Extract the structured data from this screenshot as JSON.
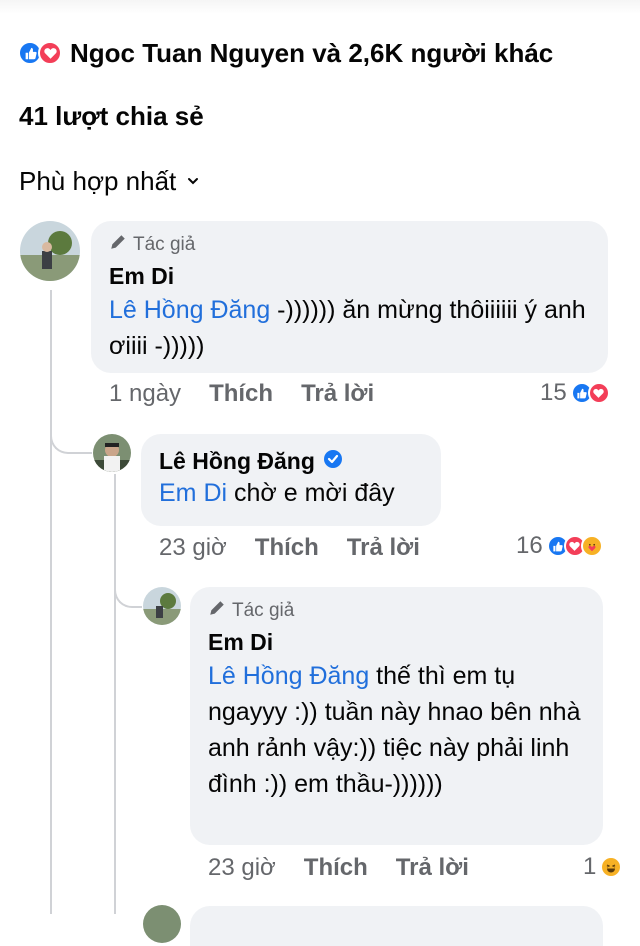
{
  "reactions_summary": {
    "icons": [
      "like-icon",
      "love-icon"
    ],
    "text": "Ngoc Tuan Nguyen và 2,6K người khác"
  },
  "shares": "41 lượt chia sẻ",
  "sort": {
    "label": "Phù hợp nhất",
    "chevron": "⌄"
  },
  "comments": [
    {
      "author_tag": "Tác giả",
      "name": "Em Di",
      "mention": "Lê Hồng Đăng",
      "text": " -)))))) ăn mừng thôiiiiii ý anh ơiiii -)))))",
      "time": "1 ngày",
      "like": "Thích",
      "reply": "Trả lời",
      "reaction_count": "15"
    },
    {
      "name": "Lê Hồng Đăng",
      "verified": true,
      "mention": "Em Di",
      "text": " chờ e mời đây",
      "time": "23 giờ",
      "like": "Thích",
      "reply": "Trả lời",
      "reaction_count": "16"
    },
    {
      "author_tag": "Tác giả",
      "name": "Em Di",
      "mention": "Lê Hồng Đăng",
      "text": " thế thì em tụ ngayyy :)) tuần này hnao bên nhà anh rảnh vậy:)) tiệc này phải linh đình :)) em thầu-))))))",
      "time": "23 giờ",
      "like": "Thích",
      "reply": "Trả lời",
      "reaction_count": "1"
    }
  ],
  "colors": {
    "like": "#1877f2",
    "love": "#f33e58",
    "mention": "#216fdb",
    "bubble": "#f0f2f5",
    "meta": "#65676b"
  }
}
